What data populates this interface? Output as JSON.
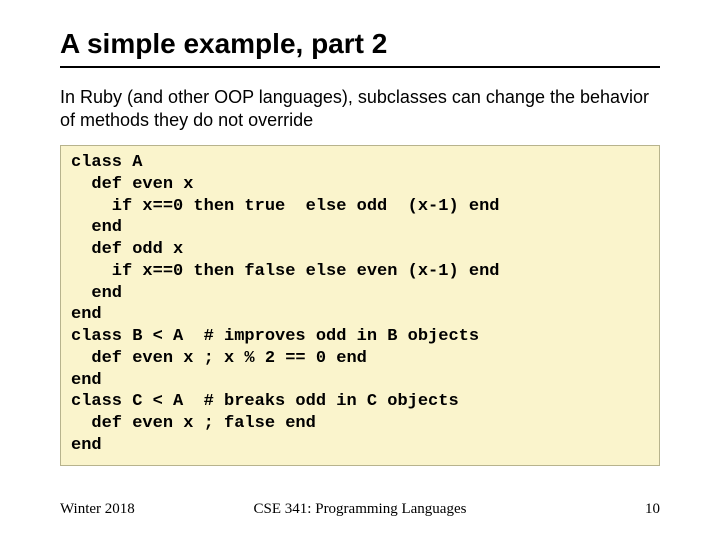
{
  "title": "A simple example, part 2",
  "body": "In Ruby (and other OOP languages), subclasses can change the behavior of methods they do not override",
  "code": "class A\n  def even x\n    if x==0 then true  else odd  (x-1) end\n  end\n  def odd x\n    if x==0 then false else even (x-1) end\n  end\nend\nclass B < A  # improves odd in B objects\n  def even x ; x % 2 == 0 end\nend\nclass C < A  # breaks odd in C objects\n  def even x ; false end\nend",
  "footer": {
    "left": "Winter 2018",
    "center": "CSE 341: Programming Languages",
    "right": "10"
  }
}
